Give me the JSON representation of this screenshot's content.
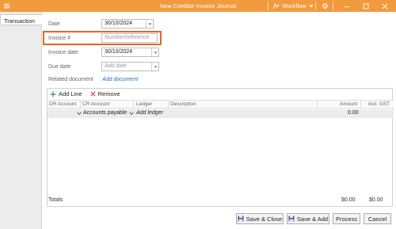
{
  "window": {
    "title": "New Creditor Invoice Journal",
    "workflow_label": "Workflow",
    "colors": {
      "titlebar": "#f19a3e",
      "highlight": "#e8622a",
      "link": "#2a6ebb"
    }
  },
  "tabs": [
    {
      "label": "Transaction"
    }
  ],
  "form": {
    "date_label": "Date",
    "date_value": "30/10/2024",
    "invoice_label": "Invoice #",
    "invoice_placeholder": "Number/reference",
    "invoice_date_label": "Invoice date",
    "invoice_date_value": "30/10/2024",
    "due_date_label": "Due date",
    "due_date_placeholder": "Add date",
    "related_label": "Related document",
    "related_link": "Add document"
  },
  "grid": {
    "add_line": "Add Line",
    "remove": "Remove",
    "columns": [
      "DR Account",
      "CR Account",
      "Ledger",
      "Description",
      "Amount",
      "Incl. GST"
    ],
    "rows": [
      {
        "dr": "",
        "cr": "Accounts payable",
        "ledger": "Add ledger",
        "description": "",
        "amount": "0.00",
        "incl_gst": ""
      }
    ]
  },
  "totals": {
    "label": "Totals",
    "amount": "$0.00",
    "incl_gst": "$0.00"
  },
  "buttons": {
    "save_close": "Save & Close",
    "save_add": "Save & Add",
    "process": "Process",
    "cancel": "Cancel"
  }
}
